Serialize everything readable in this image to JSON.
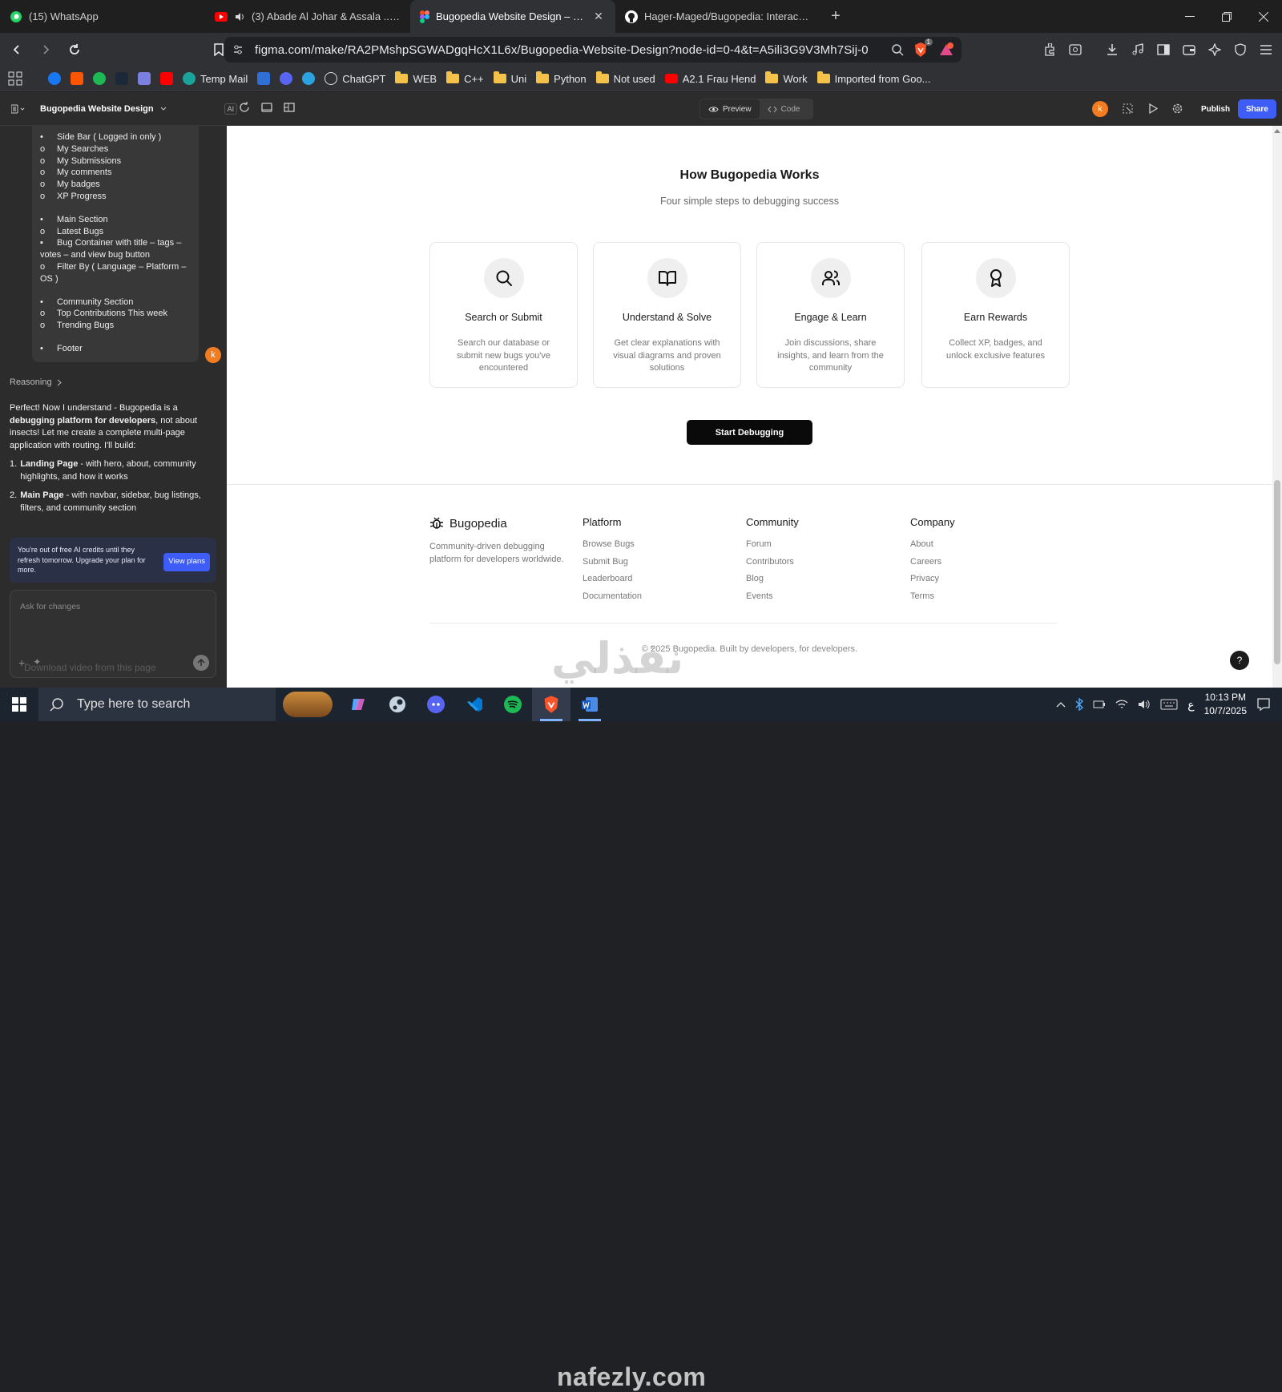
{
  "browser": {
    "tabs": [
      {
        "title": "(15) WhatsApp",
        "icon": "whatsapp-icon"
      },
      {
        "title": "(3) Abade Al Johar & Assala ... Qa",
        "icon": "youtube-icon"
      },
      {
        "title": "Bugopedia Website Design – Fig",
        "icon": "figma-icon",
        "active": true
      },
      {
        "title": "Hager-Maged/Bugopedia: Interactive",
        "icon": "github-icon"
      }
    ],
    "new_tab": "+",
    "url": "figma.com/make/RA2PMshpSGWADgqHcX1L6x/Bugopedia-Website-Design?node-id=0-4&t=A5ili3G9V3Mh7Sij-0",
    "brave_badge": "1",
    "bookmarks": [
      "Temp Mail",
      "ChatGPT",
      "WEB",
      "C++",
      "Uni",
      "Python",
      "Not used",
      "A2.1 Frau Hend",
      "Work",
      "Imported from Goo..."
    ]
  },
  "figma_toolbar": {
    "project_name": "Bugopedia Website Design",
    "ai_badge": "AI",
    "preview_label": "Preview",
    "code_label": "Code",
    "avatar_letter": "k",
    "publish_label": "Publish",
    "share_label": "Share"
  },
  "left_panel": {
    "outline": [
      {
        "bullet": "•",
        "text": "Side Bar ( Logged in only )"
      },
      {
        "bullet": "o",
        "text": "My Searches"
      },
      {
        "bullet": "o",
        "text": "My Submissions"
      },
      {
        "bullet": "o",
        "text": "My comments"
      },
      {
        "bullet": "o",
        "text": "My badges"
      },
      {
        "bullet": "o",
        "text": "XP Progress"
      },
      {
        "bullet": "",
        "text": ""
      },
      {
        "bullet": "•",
        "text": "Main Section"
      },
      {
        "bullet": "o",
        "text": "Latest Bugs"
      },
      {
        "bullet": "▪",
        "text": "Bug Container with title – tags –"
      },
      {
        "bullet": "",
        "text": "votes – and view bug button",
        "cont": true
      },
      {
        "bullet": "o",
        "text": "Filter By ( Language – Platform –"
      },
      {
        "bullet": "",
        "text": "OS )",
        "cont": true
      },
      {
        "bullet": "",
        "text": ""
      },
      {
        "bullet": "•",
        "text": "Community Section"
      },
      {
        "bullet": "o",
        "text": "Top Contributions This week"
      },
      {
        "bullet": "o",
        "text": "Trending Bugs"
      },
      {
        "bullet": "",
        "text": ""
      },
      {
        "bullet": "•",
        "text": "Footer"
      }
    ],
    "user_avatar": "k",
    "reasoning_label": "Reasoning",
    "ai_intro_1": "Perfect! Now I understand - Bugopedia is a ",
    "ai_intro_bold": "debugging platform for developers",
    "ai_intro_2": ", not about insects! Let me create a complete multi-page application with routing. I'll build:",
    "ai_items": [
      {
        "num": "1.",
        "bold": "Landing Page",
        "text": " - with hero, about, community highlights, and how it works"
      },
      {
        "num": "2.",
        "bold": "Main Page",
        "text": " - with navbar, sidebar, bug listings, filters, and community section"
      }
    ],
    "credits_text": "You're out of free AI credits until they refresh tomorrow. Upgrade your plan for more.",
    "view_plans": "View plans",
    "ask_placeholder": "Ask for changes"
  },
  "page": {
    "heading": "How Bugopedia Works",
    "subheading": "Four simple steps to debugging success",
    "steps": [
      {
        "icon": "search-icon",
        "title": "Search or Submit",
        "desc": "Search our database or submit new bugs you've encountered"
      },
      {
        "icon": "book-icon",
        "title": "Understand & Solve",
        "desc": "Get clear explanations with visual diagrams and proven solutions"
      },
      {
        "icon": "users-icon",
        "title": "Engage & Learn",
        "desc": "Join discussions, share insights, and learn from the community"
      },
      {
        "icon": "award-icon",
        "title": "Earn Rewards",
        "desc": "Collect XP, badges, and unlock exclusive features"
      }
    ],
    "cta": "Start Debugging",
    "footer": {
      "brand": "Bugopedia",
      "tagline": "Community-driven debugging platform for developers worldwide.",
      "columns": [
        {
          "heading": "Platform",
          "links": [
            "Browse Bugs",
            "Submit Bug",
            "Leaderboard",
            "Documentation"
          ]
        },
        {
          "heading": "Community",
          "links": [
            "Forum",
            "Contributors",
            "Blog",
            "Events"
          ]
        },
        {
          "heading": "Company",
          "links": [
            "About",
            "Careers",
            "Privacy",
            "Terms"
          ]
        }
      ],
      "copyright": "© 2025 Bugopedia. Built by developers, for developers."
    },
    "help": "?"
  },
  "overlay": {
    "download_hint": "Download video from this page",
    "watermark_ar": "نفذلي",
    "watermark_en": "nafezly.com"
  },
  "taskbar": {
    "search_placeholder": "Type here to search",
    "time": "10:13 PM",
    "date": "10/7/2025",
    "lang": "ع"
  },
  "colors": {
    "accent": "#3d5df6",
    "avatar": "#f47c20",
    "cta": "#0a0a0a"
  }
}
